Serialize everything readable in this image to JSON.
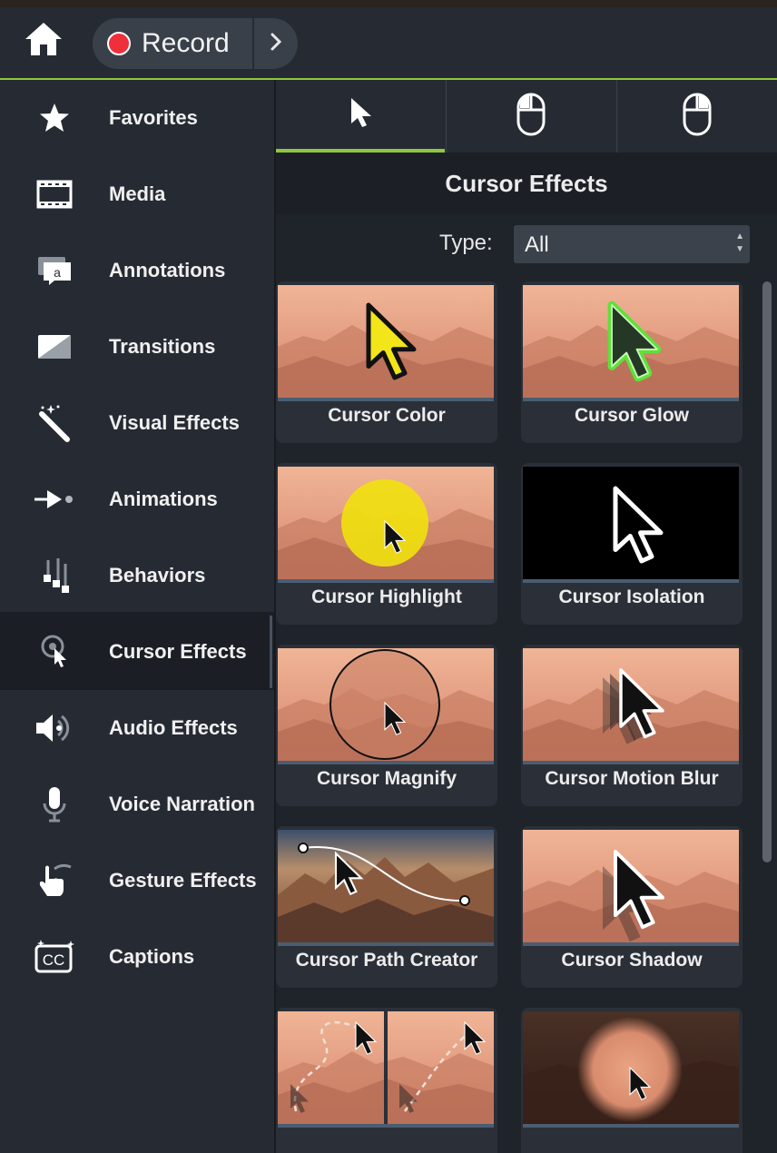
{
  "toolbar": {
    "record_label": "Record"
  },
  "sidebar": {
    "items": [
      {
        "label": "Favorites",
        "icon": "star-icon"
      },
      {
        "label": "Media",
        "icon": "film-icon"
      },
      {
        "label": "Annotations",
        "icon": "annotation-icon"
      },
      {
        "label": "Transitions",
        "icon": "transition-icon"
      },
      {
        "label": "Visual Effects",
        "icon": "magic-wand-icon"
      },
      {
        "label": "Animations",
        "icon": "animation-icon"
      },
      {
        "label": "Behaviors",
        "icon": "behaviors-icon"
      },
      {
        "label": "Cursor Effects",
        "icon": "cursor-effects-icon"
      },
      {
        "label": "Audio Effects",
        "icon": "speaker-icon"
      },
      {
        "label": "Voice Narration",
        "icon": "microphone-icon"
      },
      {
        "label": "Gesture Effects",
        "icon": "gesture-hand-icon"
      },
      {
        "label": "Captions",
        "icon": "cc-icon"
      }
    ],
    "active_item": "Cursor Effects"
  },
  "tabs": [
    {
      "icon": "cursor-arrow-icon",
      "active": true
    },
    {
      "icon": "mouse-left-click-icon",
      "active": false
    },
    {
      "icon": "mouse-right-click-icon",
      "active": false
    }
  ],
  "panel": {
    "title": "Cursor Effects",
    "type_label": "Type:",
    "type_value": "All"
  },
  "effects": [
    {
      "label": "Cursor Color"
    },
    {
      "label": "Cursor Glow"
    },
    {
      "label": "Cursor Highlight"
    },
    {
      "label": "Cursor Isolation"
    },
    {
      "label": "Cursor Magnify"
    },
    {
      "label": "Cursor Motion Blur"
    },
    {
      "label": "Cursor Path Creator"
    },
    {
      "label": "Cursor Shadow"
    },
    {
      "label": ""
    },
    {
      "label": ""
    }
  ],
  "colors": {
    "accent_green": "#8ec63f",
    "record_red": "#ef2f3c",
    "highlight_yellow": "#f0e010",
    "glow_green": "#5fe03a"
  }
}
